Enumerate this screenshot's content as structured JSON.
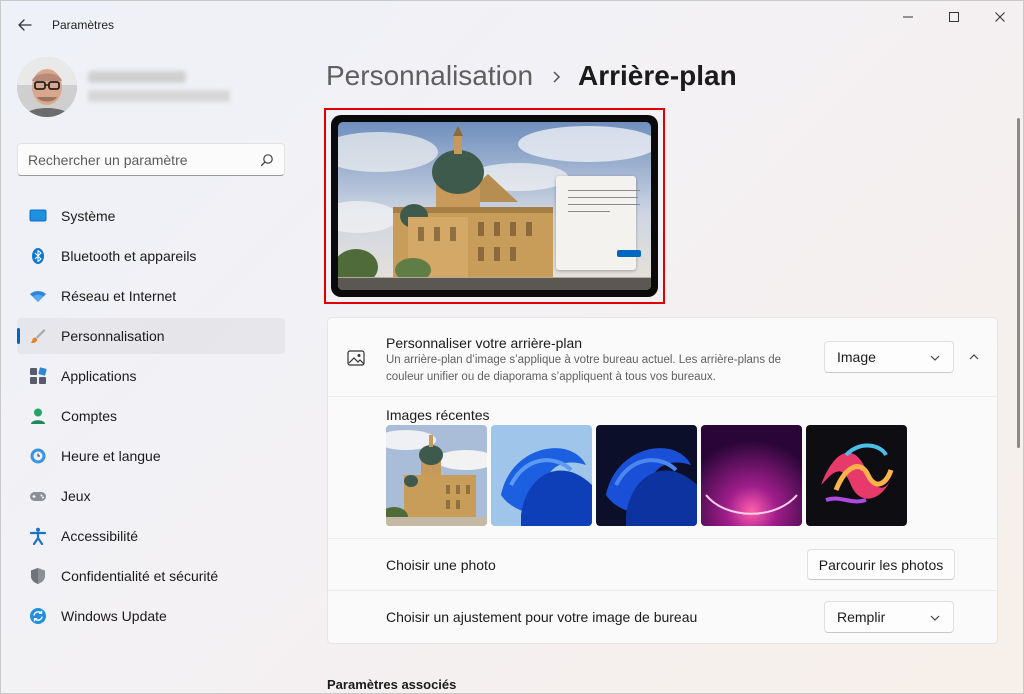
{
  "window": {
    "title": "Paramètres"
  },
  "search": {
    "placeholder": "Rechercher un paramètre"
  },
  "sidebar": {
    "items": [
      {
        "label": "Système",
        "icon": "system-icon"
      },
      {
        "label": "Bluetooth et appareils",
        "icon": "bluetooth-icon"
      },
      {
        "label": "Réseau et Internet",
        "icon": "wifi-icon"
      },
      {
        "label": "Personnalisation",
        "icon": "brush-icon",
        "active": true
      },
      {
        "label": "Applications",
        "icon": "apps-icon"
      },
      {
        "label": "Comptes",
        "icon": "account-icon"
      },
      {
        "label": "Heure et langue",
        "icon": "clock-globe-icon"
      },
      {
        "label": "Jeux",
        "icon": "gamepad-icon"
      },
      {
        "label": "Accessibilité",
        "icon": "accessibility-icon"
      },
      {
        "label": "Confidentialité et sécurité",
        "icon": "shield-icon"
      },
      {
        "label": "Windows Update",
        "icon": "update-icon"
      }
    ]
  },
  "breadcrumb": {
    "parent": "Personnalisation",
    "current": "Arrière-plan"
  },
  "background": {
    "title": "Personnaliser votre arrière-plan",
    "description": "Un arrière-plan d’image s’applique à votre bureau actuel. Les arrière-plans de couleur unifier ou de diaporama s’appliquent à tous vos bureaux.",
    "type_value": "Image"
  },
  "recent_images": {
    "label": "Images récentes",
    "items": [
      {
        "icon": "cathedral-image"
      },
      {
        "icon": "bloom-blue-light-image"
      },
      {
        "icon": "bloom-blue-dark-image"
      },
      {
        "icon": "purple-glow-image"
      },
      {
        "icon": "ribbon-flow-image"
      }
    ]
  },
  "choose_photo": {
    "label": "Choisir une photo",
    "button": "Parcourir les photos"
  },
  "fit": {
    "label": "Choisir un ajustement pour votre image de bureau",
    "value": "Remplir"
  },
  "related": {
    "title": "Paramètres associés"
  },
  "colors": {
    "accent": "#0067c0",
    "highlight_border": "#e00000"
  }
}
